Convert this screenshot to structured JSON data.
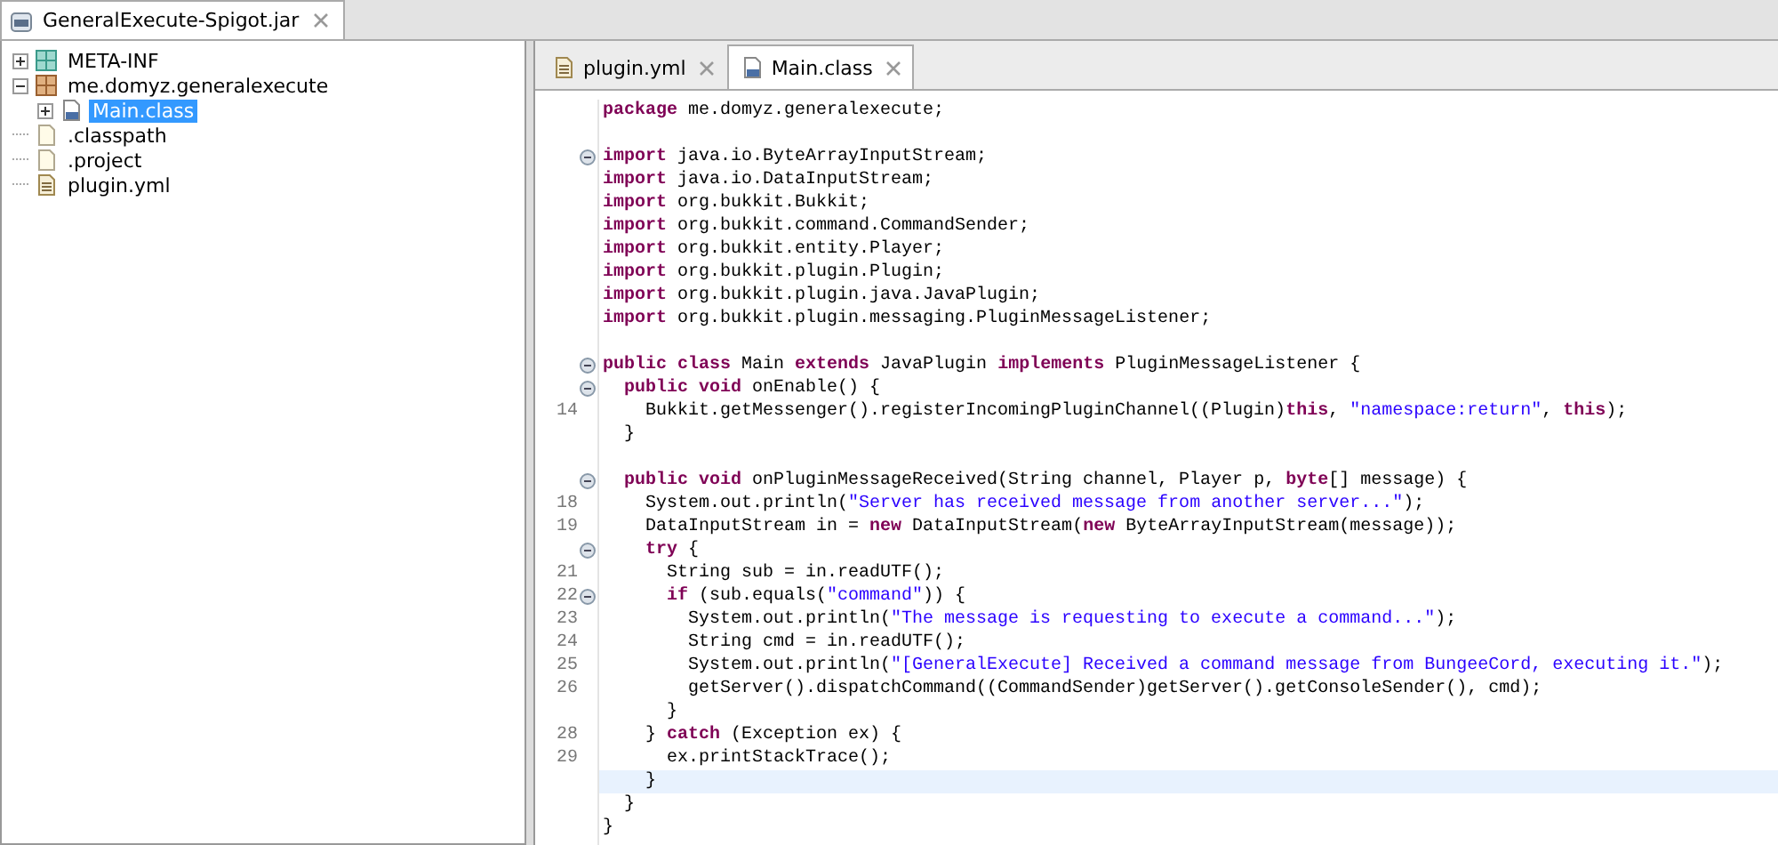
{
  "jar_tab": {
    "label": "GeneralExecute-Spigot.jar",
    "selected": true
  },
  "tree": [
    {
      "label": "META-INF",
      "kind": "folder",
      "expanded": false,
      "selected": false
    },
    {
      "label": "me.domyz.generalexecute",
      "kind": "package",
      "expanded": true,
      "selected": false,
      "children": [
        {
          "label": "Main.class",
          "kind": "class",
          "expanded": false,
          "selected": true
        }
      ]
    },
    {
      "label": ".classpath",
      "kind": "file",
      "selected": false
    },
    {
      "label": ".project",
      "kind": "file",
      "selected": false
    },
    {
      "label": "plugin.yml",
      "kind": "text",
      "selected": false
    }
  ],
  "editor_tabs": [
    {
      "label": "plugin.yml",
      "kind": "text",
      "selected": false
    },
    {
      "label": "Main.class",
      "kind": "class",
      "selected": true
    }
  ],
  "code_lines": [
    {
      "fold": false,
      "current": false,
      "tokens": [
        {
          "kind": "keyword",
          "text": "package"
        },
        {
          "kind": "plain",
          "text": " me.domyz.generalexecute;"
        }
      ]
    },
    {
      "blank_before": true,
      "fold": true,
      "current": false,
      "tokens": [
        {
          "kind": "keyword",
          "text": "import"
        },
        {
          "kind": "plain",
          "text": " java.io.ByteArrayInputStream;"
        }
      ]
    },
    {
      "fold": false,
      "current": false,
      "tokens": [
        {
          "kind": "keyword",
          "text": "import"
        },
        {
          "kind": "plain",
          "text": " java.io.DataInputStream;"
        }
      ]
    },
    {
      "fold": false,
      "current": false,
      "tokens": [
        {
          "kind": "keyword",
          "text": "import"
        },
        {
          "kind": "plain",
          "text": " org.bukkit.Bukkit;"
        }
      ]
    },
    {
      "fold": false,
      "current": false,
      "tokens": [
        {
          "kind": "keyword",
          "text": "import"
        },
        {
          "kind": "plain",
          "text": " org.bukkit.command.CommandSender;"
        }
      ]
    },
    {
      "fold": false,
      "current": false,
      "tokens": [
        {
          "kind": "keyword",
          "text": "import"
        },
        {
          "kind": "plain",
          "text": " org.bukkit.entity.Player;"
        }
      ]
    },
    {
      "fold": false,
      "current": false,
      "tokens": [
        {
          "kind": "keyword",
          "text": "import"
        },
        {
          "kind": "plain",
          "text": " org.bukkit.plugin.Plugin;"
        }
      ]
    },
    {
      "fold": false,
      "current": false,
      "tokens": [
        {
          "kind": "keyword",
          "text": "import"
        },
        {
          "kind": "plain",
          "text": " org.bukkit.plugin.java.JavaPlugin;"
        }
      ]
    },
    {
      "fold": false,
      "current": false,
      "tokens": [
        {
          "kind": "keyword",
          "text": "import"
        },
        {
          "kind": "plain",
          "text": " org.bukkit.plugin.messaging.PluginMessageListener;"
        }
      ]
    },
    {
      "blank_before": true,
      "fold": true,
      "current": false,
      "tokens": [
        {
          "kind": "keyword",
          "text": "public class"
        },
        {
          "kind": "plain",
          "text": " Main "
        },
        {
          "kind": "keyword",
          "text": "extends"
        },
        {
          "kind": "plain",
          "text": " JavaPlugin "
        },
        {
          "kind": "keyword",
          "text": "implements"
        },
        {
          "kind": "plain",
          "text": " PluginMessageListener {"
        }
      ]
    },
    {
      "fold": true,
      "current": false,
      "tokens": [
        {
          "kind": "keyword",
          "text": "  public void"
        },
        {
          "kind": "plain",
          "text": " onEnable() {"
        }
      ]
    },
    {
      "number": "14",
      "fold": false,
      "current": false,
      "tokens": [
        {
          "kind": "plain",
          "text": "    Bukkit.getMessenger().registerIncomingPluginChannel((Plugin)"
        },
        {
          "kind": "keyword",
          "text": "this"
        },
        {
          "kind": "plain",
          "text": ", "
        },
        {
          "kind": "string",
          "text": "\"namespace:return\""
        },
        {
          "kind": "plain",
          "text": ", "
        },
        {
          "kind": "keyword",
          "text": "this"
        },
        {
          "kind": "plain",
          "text": ");"
        }
      ]
    },
    {
      "fold": false,
      "current": false,
      "tokens": [
        {
          "kind": "plain",
          "text": "  }"
        }
      ]
    },
    {
      "blank_before": true,
      "fold": true,
      "current": false,
      "tokens": [
        {
          "kind": "keyword",
          "text": "  public void"
        },
        {
          "kind": "plain",
          "text": " onPluginMessageReceived(String channel, Player p, "
        },
        {
          "kind": "keyword",
          "text": "byte"
        },
        {
          "kind": "plain",
          "text": "[] message) {"
        }
      ]
    },
    {
      "number": "18",
      "fold": false,
      "current": false,
      "tokens": [
        {
          "kind": "plain",
          "text": "    System.out.println("
        },
        {
          "kind": "string",
          "text": "\"Server has received message from another server...\""
        },
        {
          "kind": "plain",
          "text": ");"
        }
      ]
    },
    {
      "number": "19",
      "fold": false,
      "current": false,
      "tokens": [
        {
          "kind": "plain",
          "text": "    DataInputStream in = "
        },
        {
          "kind": "keyword",
          "text": "new"
        },
        {
          "kind": "plain",
          "text": " DataInputStream("
        },
        {
          "kind": "keyword",
          "text": "new"
        },
        {
          "kind": "plain",
          "text": " ByteArrayInputStream(message));"
        }
      ]
    },
    {
      "fold": true,
      "current": false,
      "tokens": [
        {
          "kind": "keyword",
          "text": "    try"
        },
        {
          "kind": "plain",
          "text": " {"
        }
      ]
    },
    {
      "number": "21",
      "fold": false,
      "current": false,
      "tokens": [
        {
          "kind": "plain",
          "text": "      String sub = in.readUTF();"
        }
      ]
    },
    {
      "number": "22",
      "fold": true,
      "current": false,
      "tokens": [
        {
          "kind": "keyword",
          "text": "      if"
        },
        {
          "kind": "plain",
          "text": " (sub.equals("
        },
        {
          "kind": "string",
          "text": "\"command\""
        },
        {
          "kind": "plain",
          "text": ")) {"
        }
      ]
    },
    {
      "number": "23",
      "fold": false,
      "current": false,
      "tokens": [
        {
          "kind": "plain",
          "text": "        System.out.println("
        },
        {
          "kind": "string",
          "text": "\"The message is requesting to execute a command...\""
        },
        {
          "kind": "plain",
          "text": ");"
        }
      ]
    },
    {
      "number": "24",
      "fold": false,
      "current": false,
      "tokens": [
        {
          "kind": "plain",
          "text": "        String cmd = in.readUTF();"
        }
      ]
    },
    {
      "number": "25",
      "fold": false,
      "current": false,
      "tokens": [
        {
          "kind": "plain",
          "text": "        System.out.println("
        },
        {
          "kind": "string",
          "text": "\"[GeneralExecute] Received a command message from BungeeCord, executing it.\""
        },
        {
          "kind": "plain",
          "text": ");"
        }
      ]
    },
    {
      "number": "26",
      "fold": false,
      "current": false,
      "tokens": [
        {
          "kind": "plain",
          "text": "        getServer().dispatchCommand((CommandSender)getServer().getConsoleSender(), cmd);"
        }
      ]
    },
    {
      "fold": false,
      "current": false,
      "tokens": [
        {
          "kind": "plain",
          "text": "      }"
        }
      ]
    },
    {
      "number": "28",
      "fold": false,
      "current": false,
      "tokens": [
        {
          "kind": "plain",
          "text": "    } "
        },
        {
          "kind": "keyword",
          "text": "catch"
        },
        {
          "kind": "plain",
          "text": " (Exception ex) {"
        }
      ]
    },
    {
      "number": "29",
      "fold": false,
      "current": false,
      "tokens": [
        {
          "kind": "plain",
          "text": "      ex.printStackTrace();"
        }
      ]
    },
    {
      "fold": false,
      "current": true,
      "tokens": [
        {
          "kind": "plain",
          "text": "    }"
        }
      ]
    },
    {
      "fold": false,
      "current": false,
      "tokens": [
        {
          "kind": "plain",
          "text": "  }"
        }
      ]
    },
    {
      "fold": false,
      "current": false,
      "tokens": [
        {
          "kind": "plain",
          "text": "}"
        }
      ]
    }
  ]
}
